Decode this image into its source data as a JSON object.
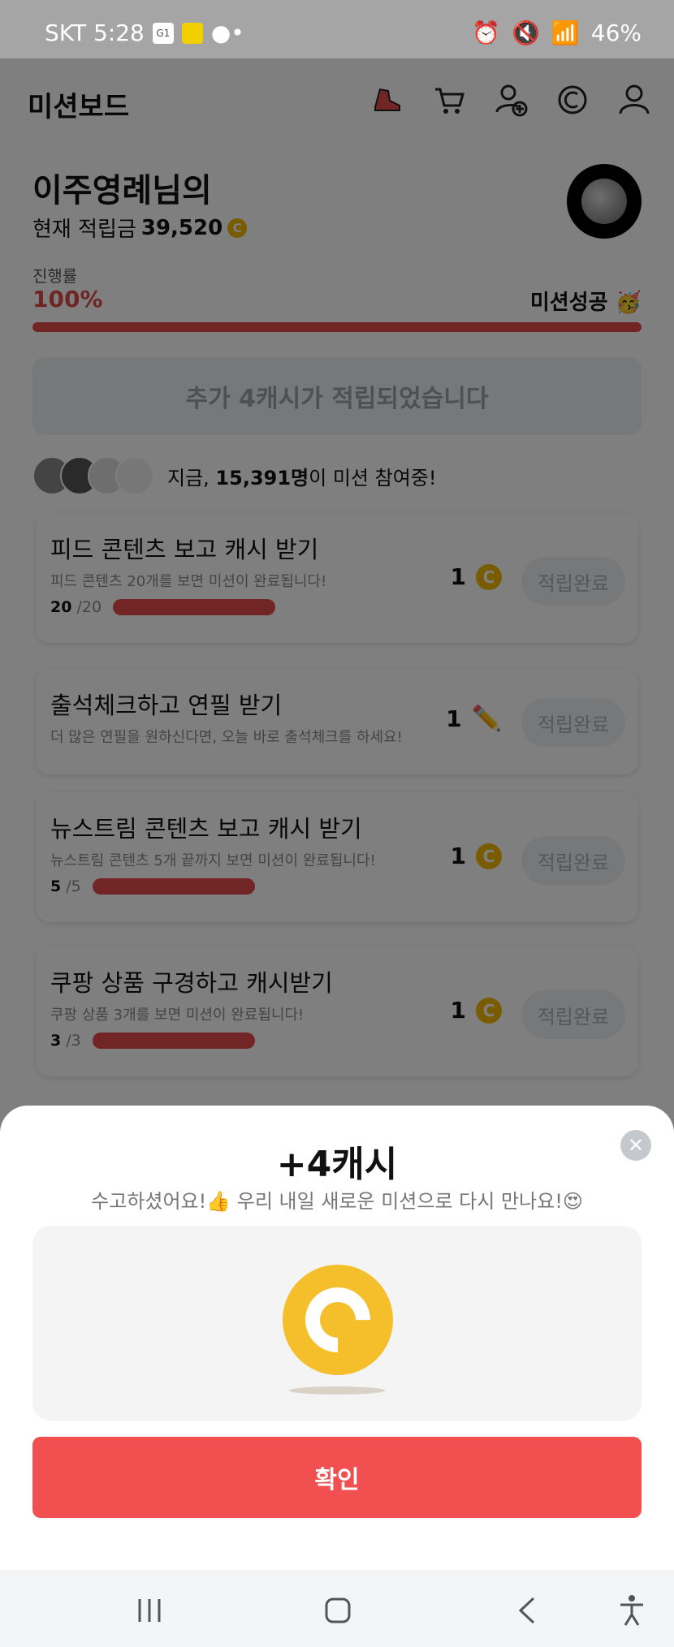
{
  "status_bar": {
    "carrier_time": "SKT 5:28",
    "battery": "46%"
  },
  "app": {
    "title": "미션보드",
    "header_icons": [
      "sneaker-icon",
      "cart-icon",
      "add-friend-icon",
      "cash-icon",
      "profile-icon"
    ],
    "user": {
      "name": "이주영례님의",
      "balance_label": "현재 적립금",
      "balance_value": "39,520"
    },
    "progress": {
      "label": "진행률",
      "percent_text": "100%",
      "percent": 100,
      "status": "미션성공 🥳"
    },
    "added_banner": "추가 4캐시가 적립되었습니다",
    "participants": {
      "prefix": "지금, ",
      "count": "15,391명",
      "suffix": "이 미션 참여중!"
    },
    "missions": [
      {
        "title": "피드 콘텐츠 보고 캐시 받기",
        "desc": "피드 콘텐츠 20개를 보면 미션이 완료됩니다!",
        "done": "20",
        "total": "/20",
        "reward": "1",
        "reward_icon": "coin-icon",
        "button": "적립완료",
        "progress": 1.0
      },
      {
        "title": "출석체크하고 연필 받기",
        "desc": "더 많은 연필을 원하신다면, 오늘 바로 출석체크를 하세요!",
        "reward": "1",
        "reward_icon": "pencil-icon",
        "button": "적립완료"
      },
      {
        "title": "뉴스트림 콘텐츠 보고 캐시 받기",
        "desc": "뉴스트림 콘텐츠 5개 끝까지 보면 미션이 완료됩니다!",
        "done": "5",
        "total": "/5",
        "reward": "1",
        "reward_icon": "coin-icon",
        "button": "적립완료",
        "progress": 1.0
      },
      {
        "title": "쿠팡 상품 구경하고 캐시받기",
        "desc": "쿠팡 상품 3개를 보면 미션이 완료됩니다!",
        "done": "3",
        "total": "/3",
        "reward": "1",
        "reward_icon": "coin-icon",
        "button": "적립완료",
        "progress": 1.0
      }
    ]
  },
  "sheet": {
    "title": "+4캐시",
    "message": "수고하셨어요!👍 우리 내일 새로운 미션으로 다시 만나요!😍",
    "confirm": "확인"
  },
  "colors": {
    "accent": "#f25050",
    "coin": "#f4bf2a",
    "progress": "#e24b4b"
  }
}
